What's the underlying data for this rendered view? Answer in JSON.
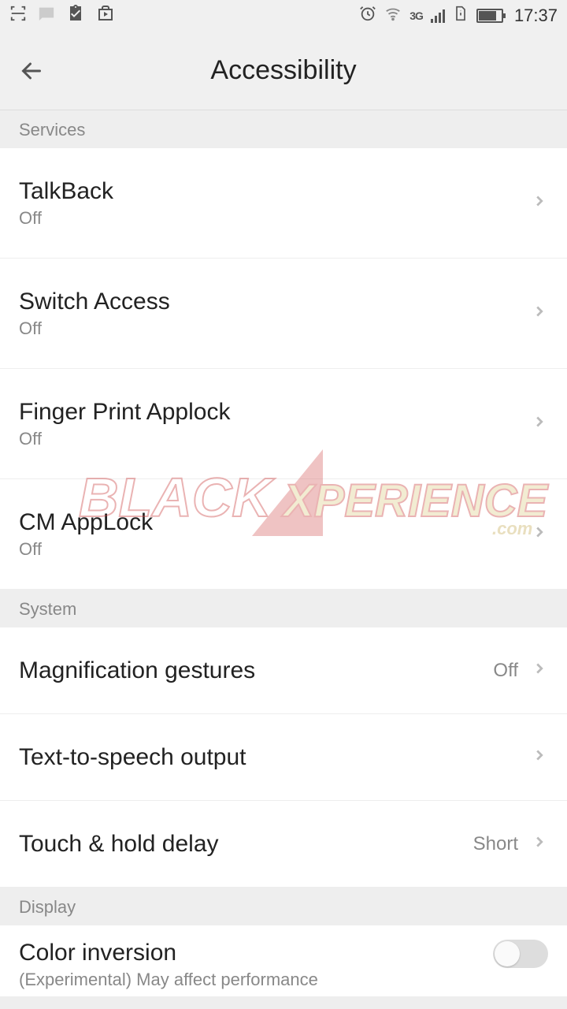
{
  "statusbar": {
    "time": "17:37",
    "network_label": "3G"
  },
  "header": {
    "title": "Accessibility"
  },
  "sections": {
    "services": {
      "label": "Services",
      "items": [
        {
          "title": "TalkBack",
          "sub": "Off"
        },
        {
          "title": "Switch Access",
          "sub": "Off"
        },
        {
          "title": "Finger Print Applock",
          "sub": "Off"
        },
        {
          "title": "CM AppLock",
          "sub": "Off"
        }
      ]
    },
    "system": {
      "label": "System",
      "items": [
        {
          "title": "Magnification gestures",
          "value": "Off"
        },
        {
          "title": "Text-to-speech output"
        },
        {
          "title": "Touch & hold delay",
          "value": "Short"
        }
      ]
    },
    "display": {
      "label": "Display",
      "items": [
        {
          "title": "Color inversion",
          "sub": "(Experimental) May affect performance",
          "toggle": false
        }
      ]
    }
  },
  "watermark": {
    "text_main": "BLACK",
    "text_sub": "XPERIENCE",
    "text_dom": ".com"
  }
}
